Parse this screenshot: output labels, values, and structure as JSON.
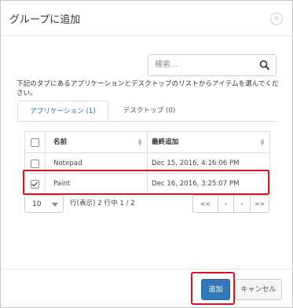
{
  "dialog": {
    "title": "グループに追加",
    "close_symbol": "×"
  },
  "search": {
    "placeholder": "検索..."
  },
  "instruction": "下記のタブにあるアプリケーションとデスクトップのリストからアイテムを選んでください。",
  "tabs": [
    {
      "label": "アプリケーション (1)",
      "active": true
    },
    {
      "label": "デスクトップ (0)",
      "active": false
    }
  ],
  "table": {
    "columns": [
      "名前",
      "最終追加"
    ],
    "rows": [
      {
        "name": "Notepad",
        "last_added": "Dec 15, 2016, 4:16:06 PM",
        "checked": false
      },
      {
        "name": "Paint",
        "last_added": "Dec 16, 2016, 3:25:07 PM",
        "checked": true
      }
    ]
  },
  "pagination": {
    "page_size": "10",
    "info": "行(表示) 2 行中 1 / 2",
    "first": "<<",
    "prev": "‹",
    "next": "›",
    "last": ">>"
  },
  "footer": {
    "add_label": "追加",
    "cancel_label": "キャンセル"
  },
  "colors": {
    "primary": "#3378b8",
    "highlight": "#d6161e",
    "tab_active": "#2a73b8"
  }
}
